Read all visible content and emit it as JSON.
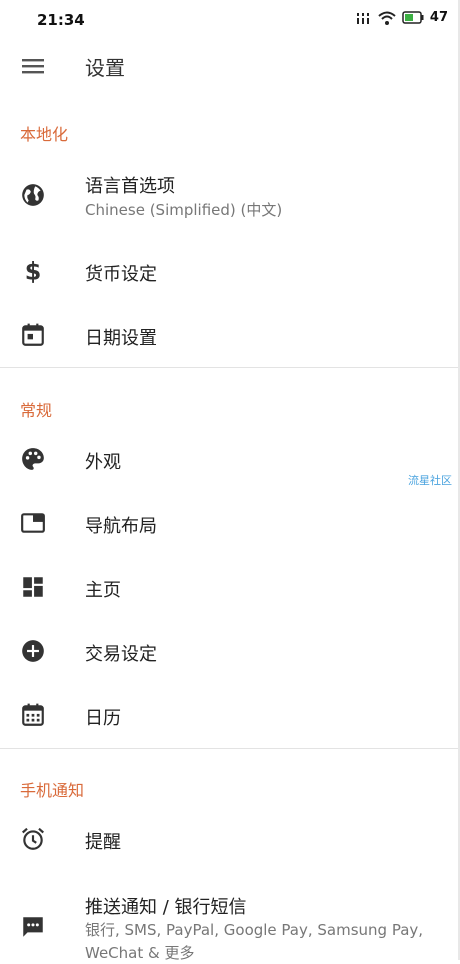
{
  "status_bar": {
    "time": "21:34",
    "battery": "47"
  },
  "app_bar": {
    "title": "设置"
  },
  "sections": {
    "localization": {
      "header": "本地化",
      "language": {
        "title": "语言首选项",
        "subtitle": "Chinese (Simplified) (中文)"
      },
      "currency": {
        "title": "货币设定"
      },
      "date": {
        "title": "日期设置"
      }
    },
    "general": {
      "header": "常规",
      "appearance": {
        "title": "外观"
      },
      "nav_layout": {
        "title": "导航布局"
      },
      "home": {
        "title": "主页"
      },
      "transaction": {
        "title": "交易设定"
      },
      "calendar": {
        "title": "日历"
      }
    },
    "notifications": {
      "header": "手机通知",
      "reminder": {
        "title": "提醒"
      },
      "push": {
        "title": "推送通知 / 银行短信",
        "subtitle_line1": "银行, SMS, PayPal, Google Pay, Samsung Pay,",
        "subtitle_line2": "WeChat & 更多"
      }
    }
  },
  "watermark": "流星社区",
  "colors": {
    "accent": "#d96a3a",
    "icon": "#333333"
  }
}
